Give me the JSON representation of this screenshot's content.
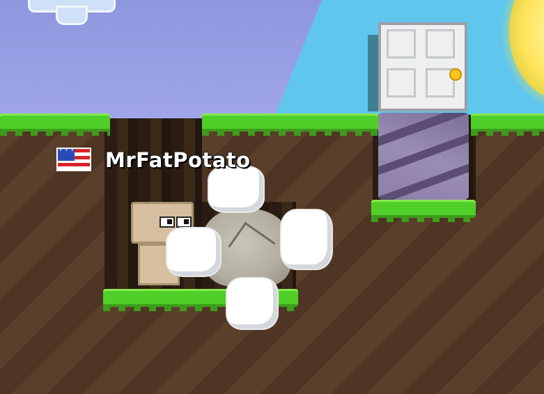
{
  "player": {
    "name": "MrFatPotato",
    "flag_icon": "us-flag-icon"
  },
  "world": {
    "items": [
      "door",
      "obsidian-block",
      "boulder",
      "dirt",
      "grass",
      "cave-background"
    ]
  },
  "colors": {
    "sky": "#a1a6ea",
    "dirt": "#5a3f2a",
    "grass": "#4fcf28",
    "name_text": "#ffffff"
  }
}
